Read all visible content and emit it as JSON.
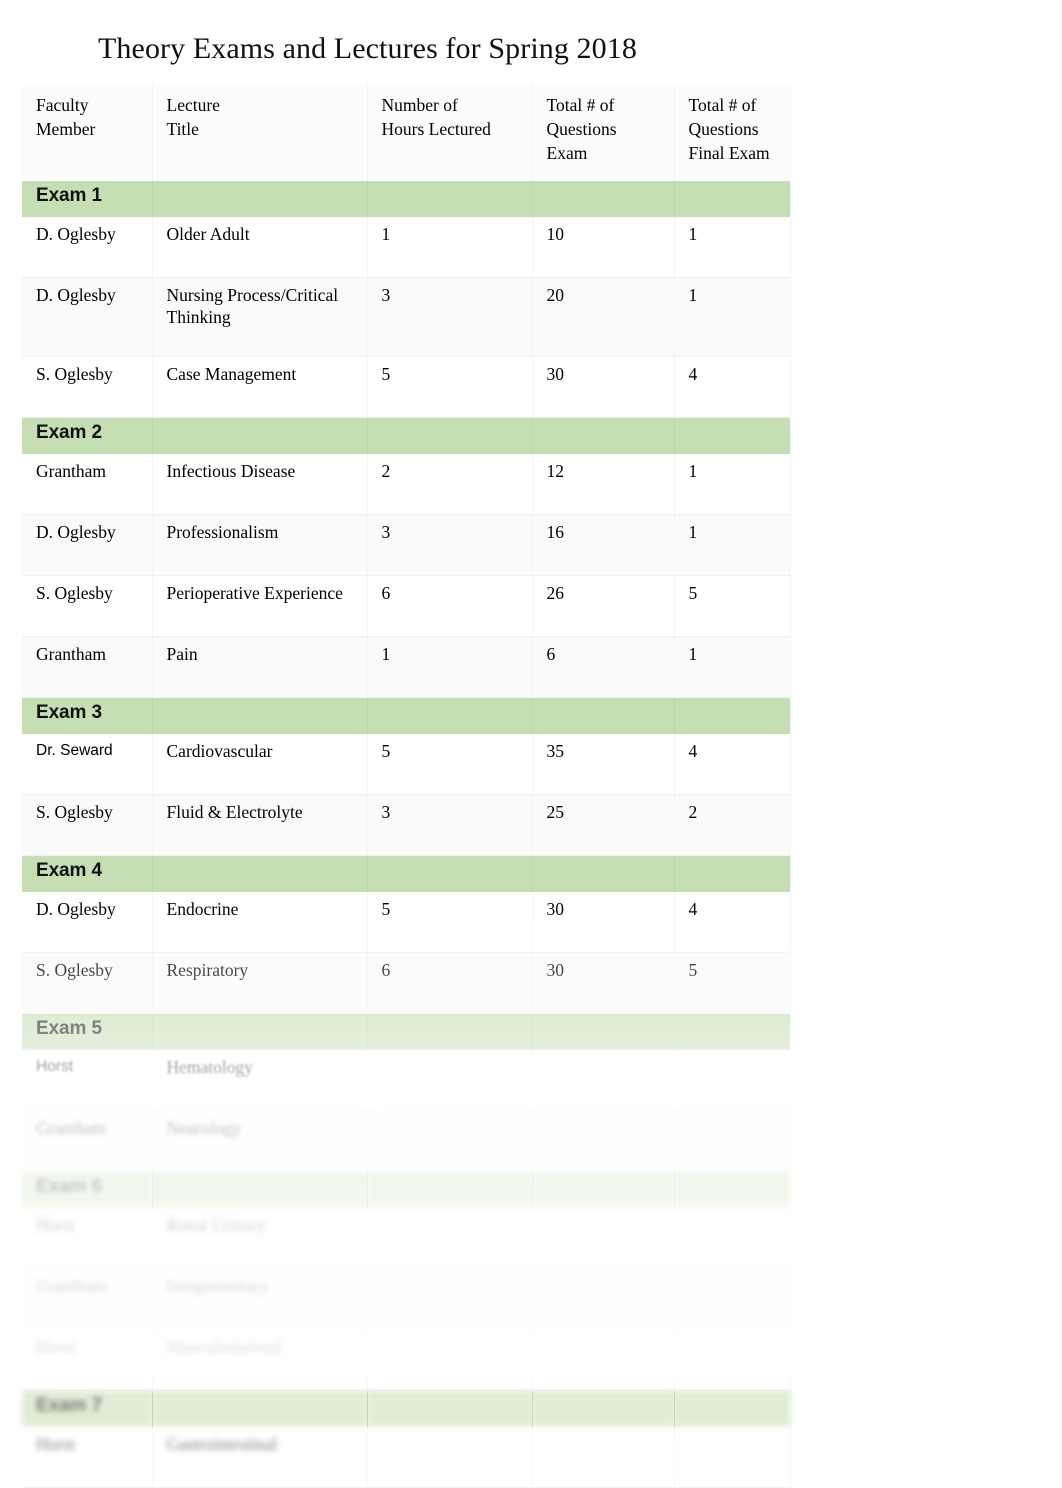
{
  "document": {
    "title": "Theory Exams and Lectures for Spring 2018",
    "accent_green": "#c5deb3",
    "text_color": "#000000",
    "page_background": "#ffffff"
  },
  "table": {
    "headers": [
      "Faculty\nMember",
      "Lecture\nTitle",
      "Number of\nHours Lectured",
      "Total # of\nQuestions\nExam",
      "Total # of\nQuestions\nFinal Exam"
    ],
    "headers_lines": {
      "faculty": [
        "Faculty",
        "Member"
      ],
      "lecture": [
        "Lecture",
        "Title"
      ],
      "hours": [
        "Number of",
        "Hours Lectured"
      ],
      "qexam": [
        "Total # of",
        "Questions",
        "Exam"
      ],
      "qfinal": [
        "Total # of",
        "Questions",
        "Final Exam"
      ]
    },
    "sections": [
      {
        "label": "Exam 1",
        "legible": true,
        "rows": [
          {
            "faculty": "D. Oglesby",
            "lecture": "Older Adult",
            "hours": "1",
            "questions_exam": "10",
            "questions_final": "1",
            "legible": true,
            "name_style": "serif"
          },
          {
            "faculty": "D. Oglesby",
            "lecture": "Nursing Process/Critical Thinking",
            "hours": "3",
            "questions_exam": "20",
            "questions_final": "1",
            "legible": true,
            "name_style": "serif"
          },
          {
            "faculty": "S. Oglesby",
            "lecture": "Case Management",
            "hours": "5",
            "questions_exam": "30",
            "questions_final": "4",
            "legible": true,
            "name_style": "serif"
          }
        ]
      },
      {
        "label": "Exam 2",
        "legible": true,
        "rows": [
          {
            "faculty": "Grantham",
            "lecture": "Infectious Disease",
            "hours": "2",
            "questions_exam": "12",
            "questions_final": "1",
            "legible": true,
            "name_style": "serif"
          },
          {
            "faculty": "D. Oglesby",
            "lecture": "Professionalism",
            "hours": "3",
            "questions_exam": "16",
            "questions_final": "1",
            "legible": true,
            "name_style": "serif"
          },
          {
            "faculty": "S. Oglesby",
            "lecture": "Perioperative Experience",
            "hours": "6",
            "questions_exam": "26",
            "questions_final": "5",
            "legible": true,
            "name_style": "serif"
          },
          {
            "faculty": "Grantham",
            "lecture": "Pain",
            "hours": "1",
            "questions_exam": "6",
            "questions_final": "1",
            "legible": true,
            "name_style": "serif"
          }
        ]
      },
      {
        "label": "Exam 3",
        "legible": true,
        "rows": [
          {
            "faculty": "Dr. Seward",
            "lecture": "Cardiovascular",
            "hours": "5",
            "questions_exam": "35",
            "questions_final": "4",
            "legible": true,
            "name_style": "sans"
          },
          {
            "faculty": "S. Oglesby",
            "lecture": "Fluid & Electrolyte",
            "hours": "3",
            "questions_exam": "25",
            "questions_final": "2",
            "legible": true,
            "name_style": "serif"
          }
        ]
      },
      {
        "label": "Exam 4",
        "legible": true,
        "rows": [
          {
            "faculty": "D. Oglesby",
            "lecture": "Endocrine",
            "hours": "5",
            "questions_exam": "30",
            "questions_final": "4",
            "legible": true,
            "name_style": "serif"
          },
          {
            "faculty": "S. Oglesby",
            "lecture": "Respiratory",
            "hours": "6",
            "questions_exam": "30",
            "questions_final": "5",
            "legible": true,
            "name_style": "serif"
          }
        ]
      },
      {
        "label": "Exam 5",
        "legible": true,
        "rows": [
          {
            "faculty": "Horst",
            "lecture": "Hematology",
            "hours": "",
            "questions_exam": "",
            "questions_final": "",
            "legible": true,
            "name_style": "sans",
            "blur": "b1"
          },
          {
            "faculty": "Grantham",
            "lecture": "Neurology",
            "hours": "",
            "questions_exam": "",
            "questions_final": "",
            "legible": false,
            "name_style": "serif",
            "blur": "b2"
          }
        ]
      },
      {
        "label": "Exam 6",
        "legible": false,
        "blur": "b2",
        "rows": [
          {
            "faculty": "Horst",
            "lecture": "Renal Urinary",
            "hours": "",
            "questions_exam": "",
            "questions_final": "",
            "legible": false,
            "name_style": "serif",
            "blur": "b3"
          },
          {
            "faculty": "Grantham",
            "lecture": "Integumentary",
            "hours": "",
            "questions_exam": "",
            "questions_final": "",
            "legible": false,
            "name_style": "serif",
            "blur": "b3"
          },
          {
            "faculty": "Horst",
            "lecture": "Musculoskeletal",
            "hours": "",
            "questions_exam": "",
            "questions_final": "",
            "legible": false,
            "name_style": "serif",
            "blur": "b3"
          }
        ]
      },
      {
        "label": "Exam 7",
        "legible": false,
        "blur": "b3",
        "rows": [
          {
            "faculty": "Horst",
            "lecture": "Gastrointestinal",
            "hours": "",
            "questions_exam": "",
            "questions_final": "",
            "legible": false,
            "name_style": "serif",
            "blur": "b4"
          }
        ]
      }
    ]
  }
}
